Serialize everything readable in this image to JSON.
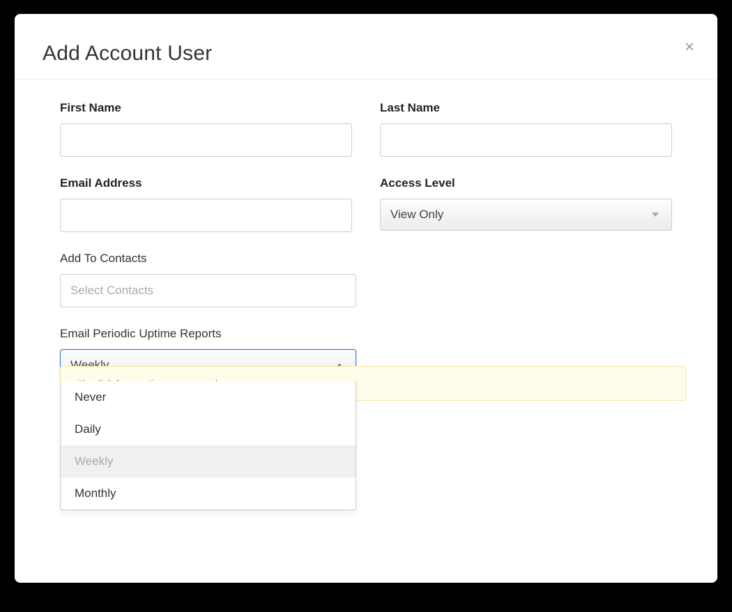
{
  "modal": {
    "title": "Add Account User"
  },
  "fields": {
    "first_name": {
      "label": "First Name",
      "value": ""
    },
    "last_name": {
      "label": "Last Name",
      "value": ""
    },
    "email": {
      "label": "Email Address",
      "value": ""
    },
    "access_level": {
      "label": "Access Level",
      "selected": "View Only"
    },
    "contacts": {
      "label": "Add To Contacts",
      "placeholder": "Select Contacts"
    },
    "uptime_reports": {
      "label": "Email Periodic Uptime Reports",
      "selected": "Weekly",
      "options": [
        "Never",
        "Daily",
        "Weekly",
        "Monthly"
      ]
    }
  },
  "footer_hint": "with a link for creating a password."
}
